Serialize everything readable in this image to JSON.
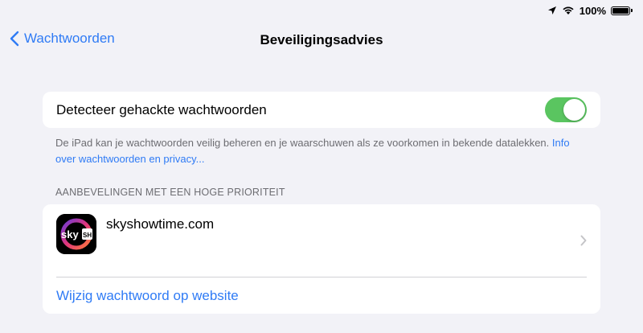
{
  "status_bar": {
    "battery_text": "100%",
    "icons": [
      "location-arrow-icon",
      "wifi-icon",
      "battery-icon"
    ]
  },
  "nav": {
    "back_label": "Wachtwoorden",
    "title": "Beveiligingsadvies"
  },
  "toggle_row": {
    "label": "Detecteer gehackte wachtwoorden",
    "enabled": true
  },
  "footer": {
    "text": "De iPad kan je wachtwoorden veilig beheren en je waarschuwen als ze voorkomen in bekende datalekken. ",
    "link": "Info over wachtwoorden en privacy..."
  },
  "section": {
    "header": "AANBEVELINGEN MET EEN HOGE PRIORITEIT"
  },
  "recommendation": {
    "site": "skyshowtime.com",
    "icon": "skyshowtime-app-icon",
    "action": "Wijzig wachtwoord op website"
  },
  "colors": {
    "accent": "#2f7bf5",
    "toggle_on": "#5ac560",
    "background": "#f2f2f7"
  }
}
